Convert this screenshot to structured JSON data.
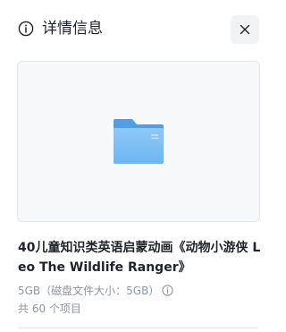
{
  "header": {
    "title": "详情信息",
    "info_icon": "info-circle-icon",
    "close_icon": "close-icon"
  },
  "preview": {
    "icon": "folder-icon",
    "folder_color": "#5aa9f0"
  },
  "details": {
    "name": "40儿童知识类英语启蒙动画《动物小游侠 Leo The Wildlife Ranger》",
    "size_text": "5GB（磁盘文件大小：5GB）",
    "help_icon": "help-circle-icon",
    "item_count": "共 60 个项目"
  }
}
